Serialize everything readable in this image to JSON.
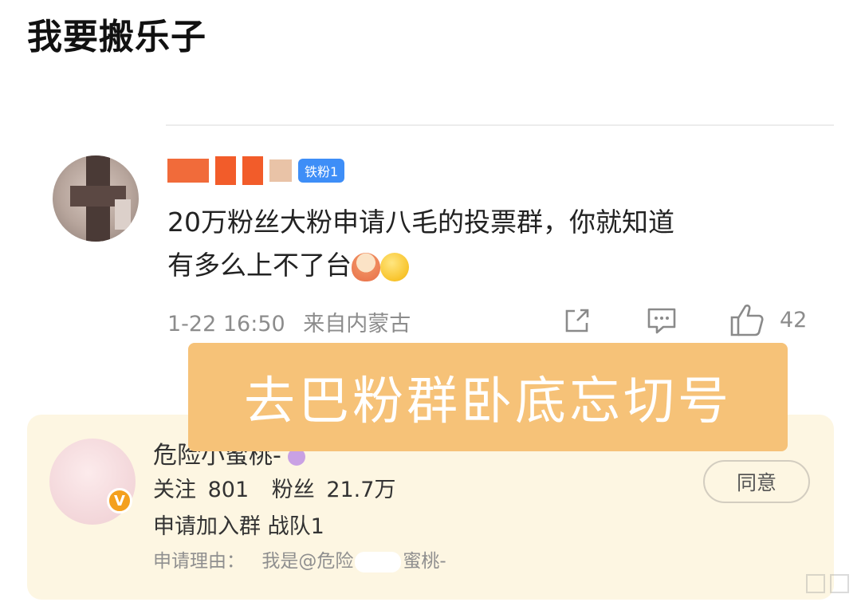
{
  "post": {
    "title": "我要搬乐子"
  },
  "comment": {
    "fan_badge": "铁粉1",
    "text_line1": "20万粉丝大粉申请八毛的投票群，你就知道",
    "text_line2": "有多么上不了台",
    "date": "1-22 16:50",
    "location": "来自内蒙古",
    "like_count": "42",
    "icons": [
      "share-icon",
      "comment-icon",
      "like-icon"
    ]
  },
  "overlay": {
    "caption": "去巴粉群卧底忘切号"
  },
  "request_card": {
    "name": "危险小蜜桃-",
    "vip_badge": "V",
    "follow_label": "关注",
    "follow_count": "801",
    "fans_label": "粉丝",
    "fans_count": "21.7万",
    "request_text": "申请加入群 战队1",
    "reason_label": "申请理由：",
    "reason_prefix": "我是@危险",
    "reason_suffix": "蜜桃-",
    "agree_label": "同意"
  },
  "colors": {
    "overlay_bg": "#f6c278",
    "card_bg": "#fdf6e2",
    "fan_badge": "#3e8ef7",
    "meta_text": "#8c8c8c"
  }
}
